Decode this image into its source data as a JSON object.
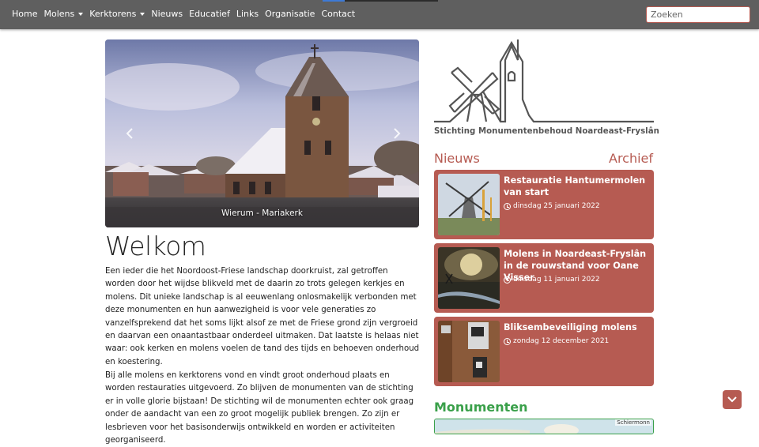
{
  "nav": {
    "items": [
      {
        "label": "Home",
        "dropdown": false
      },
      {
        "label": "Molens",
        "dropdown": true
      },
      {
        "label": "Kerktorens",
        "dropdown": true
      },
      {
        "label": "Nieuws",
        "dropdown": false
      },
      {
        "label": "Educatief",
        "dropdown": false
      },
      {
        "label": "Links",
        "dropdown": false
      },
      {
        "label": "Organisatie",
        "dropdown": false
      },
      {
        "label": "Contact",
        "dropdown": false
      }
    ],
    "search_placeholder": "Zoeken"
  },
  "carousel": {
    "caption": "Wierum - Mariakerk",
    "prev_icon": "chevron-left-icon",
    "next_icon": "chevron-right-icon"
  },
  "welcome": {
    "title": "Welkom",
    "paragraph1": "Een ieder die het Noordoost-Friese landschap doorkruist, zal getroffen worden door het wijdse blikveld met de daarin zo trots gelegen kerkjes en molens. Dit unieke landschap is al eeuwenlang onlosmakelijk verbonden met deze monumenten en hun aanwezigheid is voor vele generaties zo vanzelfsprekend dat het soms lijkt alsof ze met de Friese grond zijn vergroeid en daarvan een onaantastbaar onderdeel uitmaken. Dat laatste is helaas niet waar: ook kerken en molens voelen de tand des tijds en behoeven onderhoud en koestering.",
    "paragraph2": "Bij alle molens en kerktorens vond en vindt groot onderhoud plaats en worden restauraties uitgevoerd. Zo blijven de monumenten van de stichting er in volle glorie bijstaan! De stichting wil de monumenten echter ook graag onder de aandacht van een zo groot mogelijk publiek brengen. Zo zijn er lesbrieven voor het basisonderwijs ontwikkeld en worden er activiteiten georganiseerd."
  },
  "logo": {
    "text": "Stichting Monumentenbehoud Noardeast-Fryslân"
  },
  "news": {
    "heading": "Nieuws",
    "archive_label": "Archief",
    "items": [
      {
        "title": "Restauratie Hantumermolen van start",
        "date": "dinsdag 25 januari 2022"
      },
      {
        "title": "Molens in Noardeast-Fryslân in de rouwstand voor Oane Visser",
        "date": "dinsdag 11 januari 2022"
      },
      {
        "title": "Bliksembeveiliging molens",
        "date": "zondag 12 december 2021"
      }
    ]
  },
  "monuments": {
    "heading": "Monumenten",
    "map_label": "Schiermonn"
  },
  "colors": {
    "brand_red": "#b65b52",
    "brand_green": "#3aa04a",
    "navbar": "#5f5f5f"
  }
}
